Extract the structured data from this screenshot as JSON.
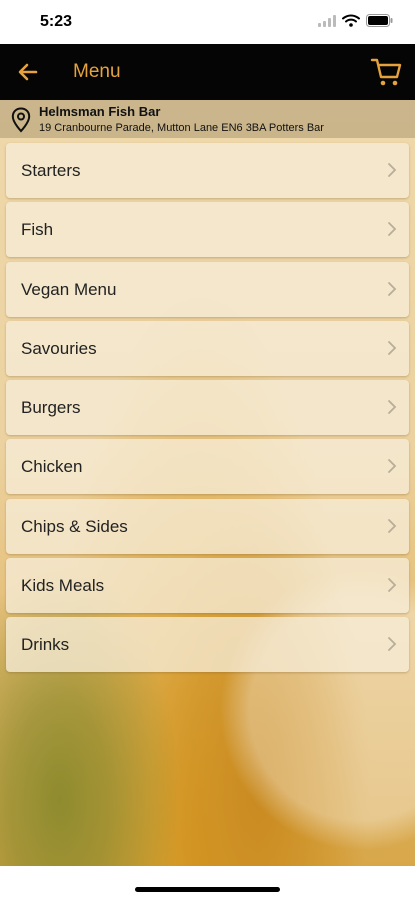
{
  "status_bar": {
    "time": "5:23"
  },
  "nav": {
    "title": "Menu"
  },
  "location": {
    "name": "Helmsman Fish Bar",
    "address": "19 Cranbourne Parade, Mutton Lane EN6 3BA Potters Bar"
  },
  "menu": {
    "items": [
      {
        "label": "Starters"
      },
      {
        "label": "Fish"
      },
      {
        "label": "Vegan Menu"
      },
      {
        "label": "Savouries"
      },
      {
        "label": "Burgers"
      },
      {
        "label": "Chicken"
      },
      {
        "label": "Chips & Sides"
      },
      {
        "label": "Kids Meals"
      },
      {
        "label": "Drinks"
      }
    ]
  },
  "colors": {
    "accent": "#e6a23c",
    "nav_background": "#050505"
  },
  "icons": {
    "back": "arrow-left-icon",
    "cart": "cart-icon",
    "location": "map-pin-icon",
    "chevron": "chevron-right-icon"
  }
}
